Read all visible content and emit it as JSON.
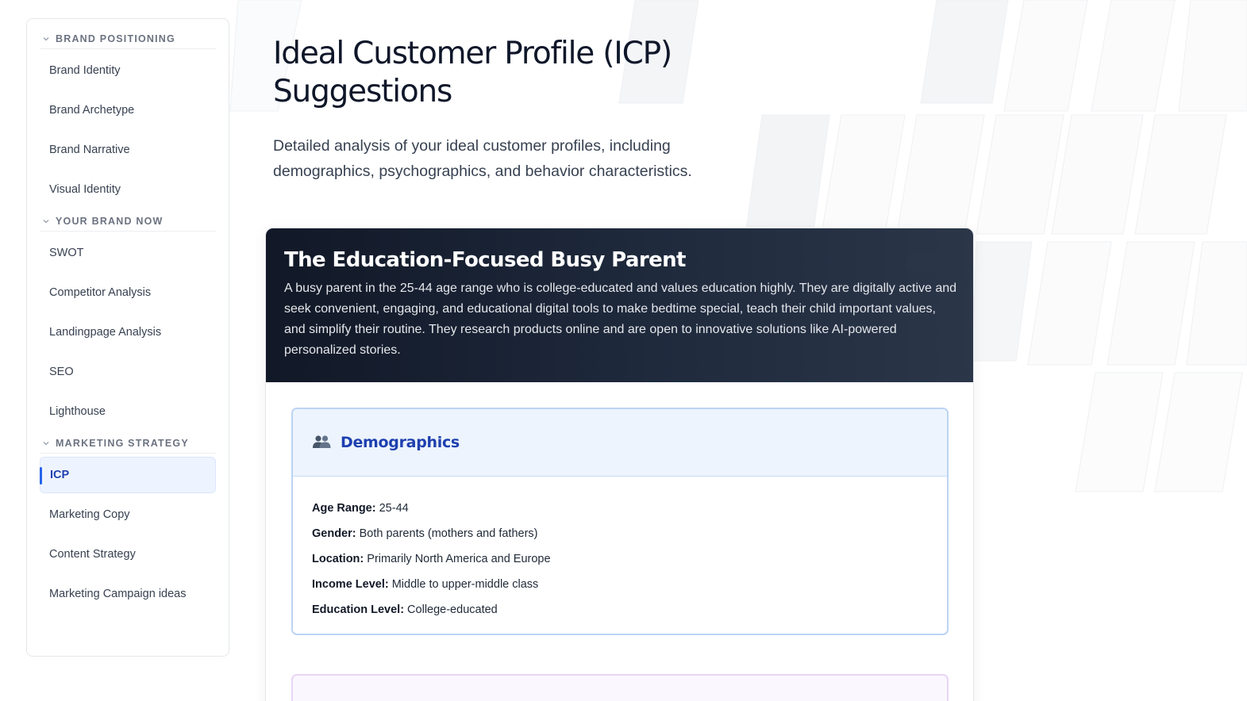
{
  "sidebar": {
    "sections": [
      {
        "title": "BRAND POSITIONING",
        "items": [
          "Brand Identity",
          "Brand Archetype",
          "Brand Narrative",
          "Visual Identity"
        ]
      },
      {
        "title": "YOUR BRAND NOW",
        "items": [
          "SWOT",
          "Competitor Analysis",
          "Landingpage Analysis",
          "SEO",
          "Lighthouse"
        ]
      },
      {
        "title": "MARKETING STRATEGY",
        "items": [
          "ICP",
          "Marketing Copy",
          "Content Strategy",
          "Marketing Campaign ideas"
        ]
      }
    ],
    "active_item": "ICP"
  },
  "main": {
    "title": "Ideal Customer Profile (ICP) Suggestions",
    "description": "Detailed analysis of your ideal customer profiles, including demographics, psychographics, and behavior characteristics."
  },
  "profile": {
    "title": "The Education-Focused Busy Parent",
    "description": "A busy parent in the 25-44 age range who is college-educated and values education highly. They are digitally active and seek convenient, engaging, and educational digital tools to make bedtime special, teach their child important values, and simplify their routine. They research products online and are open to innovative solutions like AI-powered personalized stories.",
    "demographics": {
      "icon": "people-icon",
      "heading": "Demographics",
      "rows": [
        {
          "label": "Age Range:",
          "value": " 25-44"
        },
        {
          "label": "Gender:",
          "value": " Both parents (mothers and fathers)"
        },
        {
          "label": "Location:",
          "value": " Primarily North America and Europe"
        },
        {
          "label": "Income Level:",
          "value": " Middle to upper-middle class"
        },
        {
          "label": "Education Level:",
          "value": " College-educated"
        }
      ]
    }
  },
  "colors": {
    "accent": "#2563eb",
    "header_dark": "#111827",
    "demographics_blue": "#1e40af"
  }
}
